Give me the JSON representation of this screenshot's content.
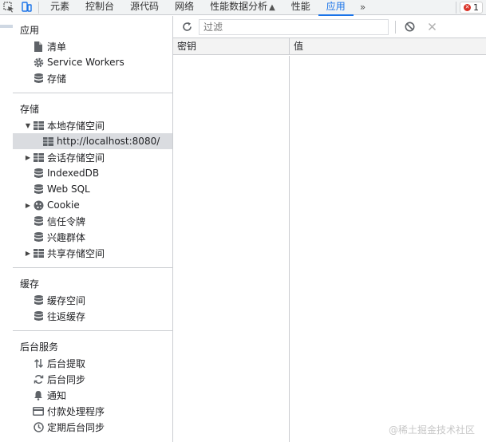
{
  "tabs": [
    {
      "label": "元素"
    },
    {
      "label": "控制台"
    },
    {
      "label": "源代码"
    },
    {
      "label": "网络"
    },
    {
      "label": "性能数据分析"
    },
    {
      "label": "性能"
    },
    {
      "label": "应用"
    }
  ],
  "active_tab": "应用",
  "more_label": "»",
  "error_count": "1",
  "sidebar": {
    "app": {
      "title": "应用",
      "items": [
        {
          "label": "清单",
          "icon": "file-icon"
        },
        {
          "label": "Service Workers",
          "icon": "gear-icon"
        },
        {
          "label": "存储",
          "icon": "database-icon"
        }
      ]
    },
    "storage": {
      "title": "存储",
      "local_storage": "本地存储空间",
      "local_origin": "http://localhost:8080/",
      "session_storage": "会话存储空间",
      "indexeddb": "IndexedDB",
      "websql": "Web SQL",
      "cookie": "Cookie",
      "trust_tokens": "信任令牌",
      "interest_groups": "兴趣群体",
      "shared_storage": "共享存储空间"
    },
    "cache": {
      "title": "缓存",
      "cache_storage": "缓存空间",
      "bfcache": "往返缓存"
    },
    "background": {
      "title": "后台服务",
      "fetch": "后台提取",
      "sync": "后台同步",
      "notifications": "通知",
      "payment": "付款处理程序",
      "periodic_sync": "定期后台同步"
    }
  },
  "toolbar": {
    "filter_placeholder": "过滤"
  },
  "table": {
    "key_header": "密钥",
    "value_header": "值"
  },
  "watermark": "@稀土掘金技术社区",
  "colors": {
    "accent": "#1a73e8",
    "error": "#d93025",
    "selected_row": "#dadce0"
  }
}
